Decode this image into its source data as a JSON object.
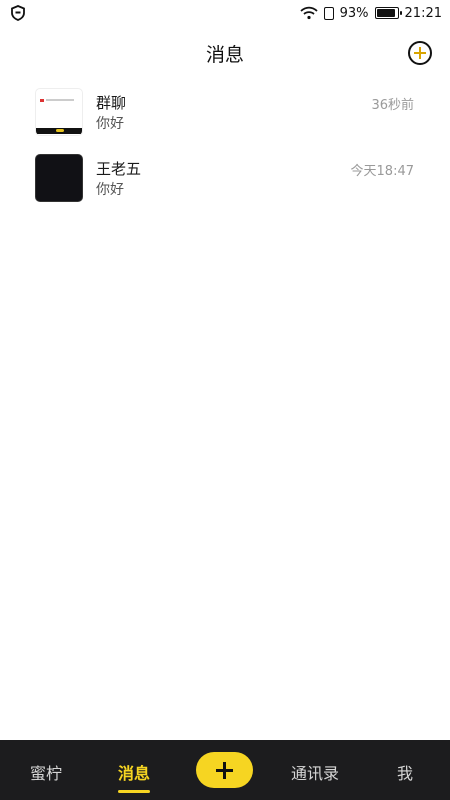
{
  "status_bar": {
    "battery_percent": "93%",
    "time": "21:21",
    "battery_level": 0.93
  },
  "header": {
    "title": "消息"
  },
  "conversations": [
    {
      "name": "群聊",
      "last_message": "你好",
      "time": "36秒前",
      "avatar": "group-thumbnail"
    },
    {
      "name": "王老五",
      "last_message": "你好",
      "time": "今天18:47",
      "avatar": "dark-thumbnail"
    }
  ],
  "bottom_nav": {
    "items": [
      "蜜柠",
      "消息",
      "通讯录",
      "我"
    ],
    "active": "消息",
    "accent_color": "#f6d522",
    "background_color": "#1c1c1e"
  }
}
